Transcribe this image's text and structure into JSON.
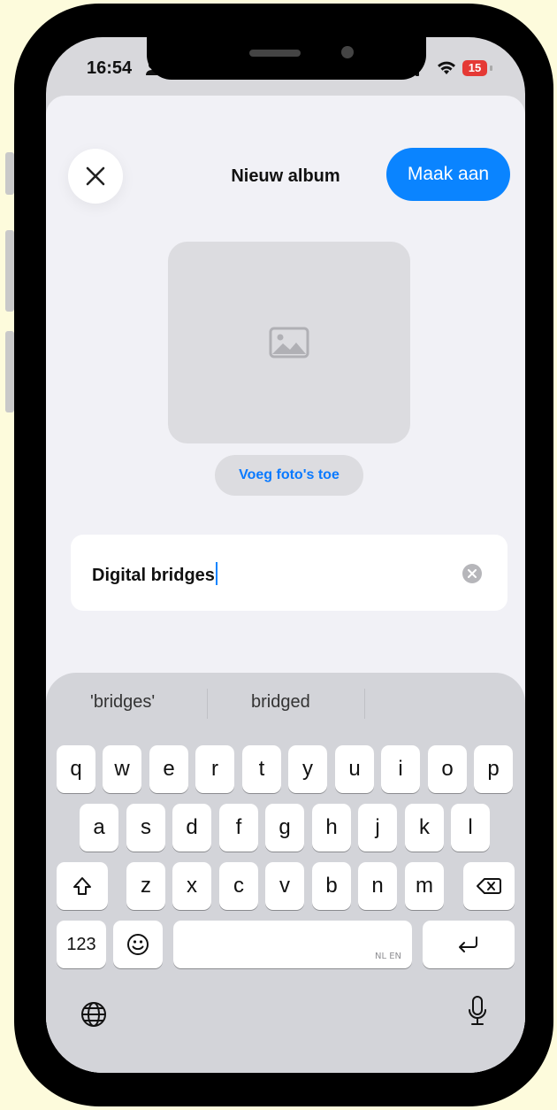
{
  "status_bar": {
    "time": "16:54",
    "battery": "15"
  },
  "header": {
    "title": "Nieuw album",
    "create_label": "Maak aan"
  },
  "cover": {
    "add_photos_label": "Voeg foto's toe"
  },
  "name_field": {
    "value": "Digital bridges"
  },
  "keyboard": {
    "suggestions": [
      "'bridges'",
      "bridged"
    ],
    "row1": [
      "q",
      "w",
      "e",
      "r",
      "t",
      "y",
      "u",
      "i",
      "o",
      "p"
    ],
    "row2": [
      "a",
      "s",
      "d",
      "f",
      "g",
      "h",
      "j",
      "k",
      "l"
    ],
    "row3": [
      "z",
      "x",
      "c",
      "v",
      "b",
      "n",
      "m"
    ],
    "numbers_label": "123",
    "space_languages": "NL EN"
  },
  "colors": {
    "accent": "#0a84ff",
    "battery_low": "#e53935",
    "sheet_bg": "#f1f1f6",
    "keyboard_bg": "#d3d4d9"
  },
  "icons": [
    "close-icon",
    "image-placeholder-icon",
    "clear-icon",
    "shift-icon",
    "backspace-icon",
    "emoji-icon",
    "return-icon",
    "globe-icon",
    "mic-icon"
  ]
}
